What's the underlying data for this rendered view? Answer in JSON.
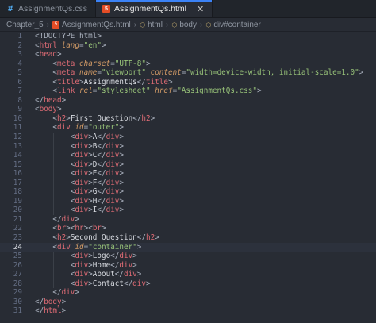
{
  "tabs": [
    {
      "label": "AssignmentQs.css",
      "icon": "css-file-icon",
      "active": false
    },
    {
      "label": "AssignmentQs.html",
      "icon": "html-file-icon",
      "active": true
    }
  ],
  "breadcrumb": [
    "Chapter_5",
    "AssignmentQs.html",
    "html",
    "body",
    "div#container"
  ],
  "current_line": 24,
  "lines": [
    [
      [
        "p",
        "<!DOCTYPE html>"
      ]
    ],
    [
      [
        "p",
        "<"
      ],
      [
        "t",
        "html"
      ],
      [
        "p",
        " "
      ],
      [
        "a",
        "lang"
      ],
      [
        "p",
        "="
      ],
      [
        "s",
        "\"en\""
      ],
      [
        "p",
        ">"
      ]
    ],
    [
      [
        "p",
        "<"
      ],
      [
        "t",
        "head"
      ],
      [
        "p",
        ">"
      ]
    ],
    [
      [
        "p",
        "    <"
      ],
      [
        "t",
        "meta"
      ],
      [
        "p",
        " "
      ],
      [
        "a",
        "charset"
      ],
      [
        "p",
        "="
      ],
      [
        "s",
        "\"UTF-8\""
      ],
      [
        "p",
        ">"
      ]
    ],
    [
      [
        "p",
        "    <"
      ],
      [
        "t",
        "meta"
      ],
      [
        "p",
        " "
      ],
      [
        "a",
        "name"
      ],
      [
        "p",
        "="
      ],
      [
        "s",
        "\"viewport\""
      ],
      [
        "p",
        " "
      ],
      [
        "a",
        "content"
      ],
      [
        "p",
        "="
      ],
      [
        "s",
        "\"width=device-width, initial-scale=1.0\""
      ],
      [
        "p",
        ">"
      ]
    ],
    [
      [
        "p",
        "    <"
      ],
      [
        "t",
        "title"
      ],
      [
        "p",
        ">"
      ],
      [
        "tx",
        "AssignmentQs"
      ],
      [
        "p",
        "</"
      ],
      [
        "t",
        "title"
      ],
      [
        "p",
        ">"
      ]
    ],
    [
      [
        "p",
        "    <"
      ],
      [
        "t",
        "link"
      ],
      [
        "p",
        " "
      ],
      [
        "a",
        "rel"
      ],
      [
        "p",
        "="
      ],
      [
        "s",
        "\"stylesheet\""
      ],
      [
        "p",
        " "
      ],
      [
        "a",
        "href"
      ],
      [
        "p",
        "="
      ],
      [
        "su",
        "\"AssignmentQs.css\""
      ],
      [
        "p",
        ">"
      ]
    ],
    [
      [
        "p",
        "</"
      ],
      [
        "t",
        "head"
      ],
      [
        "p",
        ">"
      ]
    ],
    [
      [
        "p",
        "<"
      ],
      [
        "t",
        "body"
      ],
      [
        "p",
        ">"
      ]
    ],
    [
      [
        "p",
        "    <"
      ],
      [
        "t",
        "h2"
      ],
      [
        "p",
        ">"
      ],
      [
        "tx",
        "First Question"
      ],
      [
        "p",
        "</"
      ],
      [
        "t",
        "h2"
      ],
      [
        "p",
        ">"
      ]
    ],
    [
      [
        "p",
        "    <"
      ],
      [
        "t",
        "div"
      ],
      [
        "p",
        " "
      ],
      [
        "a",
        "id"
      ],
      [
        "p",
        "="
      ],
      [
        "s",
        "\"outer\""
      ],
      [
        "p",
        ">"
      ]
    ],
    [
      [
        "p",
        "        <"
      ],
      [
        "t",
        "div"
      ],
      [
        "p",
        ">"
      ],
      [
        "tx",
        "A"
      ],
      [
        "p",
        "</"
      ],
      [
        "t",
        "div"
      ],
      [
        "p",
        ">"
      ]
    ],
    [
      [
        "p",
        "        <"
      ],
      [
        "t",
        "div"
      ],
      [
        "p",
        ">"
      ],
      [
        "tx",
        "B"
      ],
      [
        "p",
        "</"
      ],
      [
        "t",
        "div"
      ],
      [
        "p",
        ">"
      ]
    ],
    [
      [
        "p",
        "        <"
      ],
      [
        "t",
        "div"
      ],
      [
        "p",
        ">"
      ],
      [
        "tx",
        "C"
      ],
      [
        "p",
        "</"
      ],
      [
        "t",
        "div"
      ],
      [
        "p",
        ">"
      ]
    ],
    [
      [
        "p",
        "        <"
      ],
      [
        "t",
        "div"
      ],
      [
        "p",
        ">"
      ],
      [
        "tx",
        "D"
      ],
      [
        "p",
        "</"
      ],
      [
        "t",
        "div"
      ],
      [
        "p",
        ">"
      ]
    ],
    [
      [
        "p",
        "        <"
      ],
      [
        "t",
        "div"
      ],
      [
        "p",
        ">"
      ],
      [
        "tx",
        "E"
      ],
      [
        "p",
        "</"
      ],
      [
        "t",
        "div"
      ],
      [
        "p",
        ">"
      ]
    ],
    [
      [
        "p",
        "        <"
      ],
      [
        "t",
        "div"
      ],
      [
        "p",
        ">"
      ],
      [
        "tx",
        "F"
      ],
      [
        "p",
        "</"
      ],
      [
        "t",
        "div"
      ],
      [
        "p",
        ">"
      ]
    ],
    [
      [
        "p",
        "        <"
      ],
      [
        "t",
        "div"
      ],
      [
        "p",
        ">"
      ],
      [
        "tx",
        "G"
      ],
      [
        "p",
        "</"
      ],
      [
        "t",
        "div"
      ],
      [
        "p",
        ">"
      ]
    ],
    [
      [
        "p",
        "        <"
      ],
      [
        "t",
        "div"
      ],
      [
        "p",
        ">"
      ],
      [
        "tx",
        "H"
      ],
      [
        "p",
        "</"
      ],
      [
        "t",
        "div"
      ],
      [
        "p",
        ">"
      ]
    ],
    [
      [
        "p",
        "        <"
      ],
      [
        "t",
        "div"
      ],
      [
        "p",
        ">"
      ],
      [
        "tx",
        "I"
      ],
      [
        "p",
        "</"
      ],
      [
        "t",
        "div"
      ],
      [
        "p",
        ">"
      ]
    ],
    [
      [
        "p",
        "    </"
      ],
      [
        "t",
        "div"
      ],
      [
        "p",
        ">"
      ]
    ],
    [
      [
        "p",
        "    <"
      ],
      [
        "t",
        "br"
      ],
      [
        "p",
        "><"
      ],
      [
        "t",
        "hr"
      ],
      [
        "p",
        "><"
      ],
      [
        "t",
        "br"
      ],
      [
        "p",
        ">"
      ]
    ],
    [
      [
        "p",
        "    <"
      ],
      [
        "t",
        "h2"
      ],
      [
        "p",
        ">"
      ],
      [
        "tx",
        "Second Question"
      ],
      [
        "p",
        "</"
      ],
      [
        "t",
        "h2"
      ],
      [
        "p",
        ">"
      ]
    ],
    [
      [
        "p",
        "    <"
      ],
      [
        "t",
        "div"
      ],
      [
        "p",
        " "
      ],
      [
        "a",
        "id"
      ],
      [
        "p",
        "="
      ],
      [
        "s",
        "\"container\""
      ],
      [
        "p",
        ">"
      ]
    ],
    [
      [
        "p",
        "        <"
      ],
      [
        "t",
        "div"
      ],
      [
        "p",
        ">"
      ],
      [
        "tx",
        "Logo"
      ],
      [
        "p",
        "</"
      ],
      [
        "t",
        "div"
      ],
      [
        "p",
        ">"
      ]
    ],
    [
      [
        "p",
        "        <"
      ],
      [
        "t",
        "div"
      ],
      [
        "p",
        ">"
      ],
      [
        "tx",
        "Home"
      ],
      [
        "p",
        "</"
      ],
      [
        "t",
        "div"
      ],
      [
        "p",
        ">"
      ]
    ],
    [
      [
        "p",
        "        <"
      ],
      [
        "t",
        "div"
      ],
      [
        "p",
        ">"
      ],
      [
        "tx",
        "About"
      ],
      [
        "p",
        "</"
      ],
      [
        "t",
        "div"
      ],
      [
        "p",
        ">"
      ]
    ],
    [
      [
        "p",
        "        <"
      ],
      [
        "t",
        "div"
      ],
      [
        "p",
        ">"
      ],
      [
        "tx",
        "Contact"
      ],
      [
        "p",
        "</"
      ],
      [
        "t",
        "div"
      ],
      [
        "p",
        ">"
      ]
    ],
    [
      [
        "p",
        "    </"
      ],
      [
        "t",
        "div"
      ],
      [
        "p",
        ">"
      ]
    ],
    [
      [
        "p",
        "</"
      ],
      [
        "t",
        "body"
      ],
      [
        "p",
        ">"
      ]
    ],
    [
      [
        "p",
        "</"
      ],
      [
        "t",
        "html"
      ],
      [
        "p",
        ">"
      ]
    ]
  ]
}
